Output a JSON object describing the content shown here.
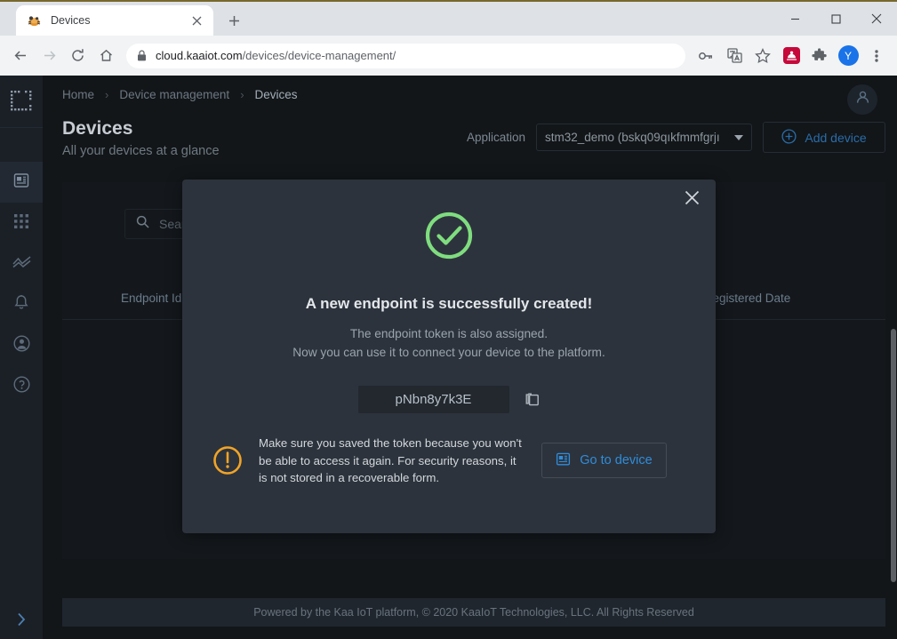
{
  "browser": {
    "tab": {
      "title": "Devices",
      "favicon_icon": "kaa-bug-favicon",
      "close_icon": "close-icon"
    },
    "newtab_icon": "plus-icon",
    "window_controls": {
      "minimize": "minimize-icon",
      "maximize": "maximize-icon",
      "close": "close-icon"
    },
    "nav": {
      "back_icon": "back-arrow-icon",
      "forward_icon": "forward-arrow-icon",
      "reload_icon": "reload-icon",
      "home_icon": "home-icon"
    },
    "omnibox": {
      "lock_icon": "lock-icon",
      "url_host": "cloud.kaaiot.com",
      "url_path": "/devices/device-management/"
    },
    "toolbar_icons": [
      "key-icon",
      "translate-icon",
      "bookmark-star-icon",
      "extension-red-icon",
      "extensions-puzzle-icon"
    ],
    "profile_initial": "Y",
    "menu_icon": "three-dot-menu-icon"
  },
  "sidebar": {
    "logo_icon": "kaa-dotted-square-logo",
    "items": [
      {
        "icon": "device-chip-icon",
        "name": "device-management",
        "active": true
      },
      {
        "icon": "apps-grid-icon",
        "name": "applications",
        "active": false
      },
      {
        "icon": "analytics-chart-icon",
        "name": "analytics",
        "active": false
      },
      {
        "icon": "bell-icon",
        "name": "notifications",
        "active": false
      },
      {
        "icon": "user-circle-icon",
        "name": "account",
        "active": false
      },
      {
        "icon": "help-circle-icon",
        "name": "help",
        "active": false
      }
    ],
    "expand_icon": "chevron-right-icon"
  },
  "header": {
    "breadcrumb": [
      {
        "label": "Home",
        "current": false
      },
      {
        "label": "Device management",
        "current": false
      },
      {
        "label": "Devices",
        "current": true
      }
    ],
    "breadcrumb_separator": "›",
    "avatar_icon": "user-avatar-icon"
  },
  "main": {
    "title": "Devices",
    "subtitle": "All your devices at a glance",
    "application_label": "Application",
    "application_value": "stm32_demo (bskq09qıkfmmfgrjı",
    "application_caret_icon": "chevron-down-icon",
    "add_device_label": "Add device",
    "add_device_icon": "circle-plus-icon",
    "search_placeholder": "Search",
    "search_icon": "search-icon",
    "search_value": "",
    "table": {
      "columns": [
        "Endpoint Id",
        "ion Registered Date"
      ]
    }
  },
  "footer": {
    "text": "Powered by the Kaa IoT platform, © 2020 KaaIoT Technologies, LLC. All Rights Reserved"
  },
  "modal": {
    "close_icon": "close-icon",
    "success_icon": "check-circle-icon",
    "heading": "A new endpoint is successfully created!",
    "line1": "The endpoint token is also assigned.",
    "line2": "Now you can use it to connect your device to the platform.",
    "token": "pNbn8y7k3E",
    "copy_icon": "copy-icon",
    "warning_icon": "warning-exclamation-icon",
    "warning_text": "Make sure you saved the token because you won't be able to access it again. For security reasons, it is not stored in a recoverable form.",
    "goto_label": "Go to device",
    "goto_icon": "device-chip-icon"
  },
  "colors": {
    "success_green": "#7fdd7f",
    "warning_orange": "#f0a427",
    "link_blue": "#2f8ddb",
    "page_bg": "#121619",
    "modal_bg": "#2d333c",
    "sidebar_bg": "#1b2027"
  }
}
